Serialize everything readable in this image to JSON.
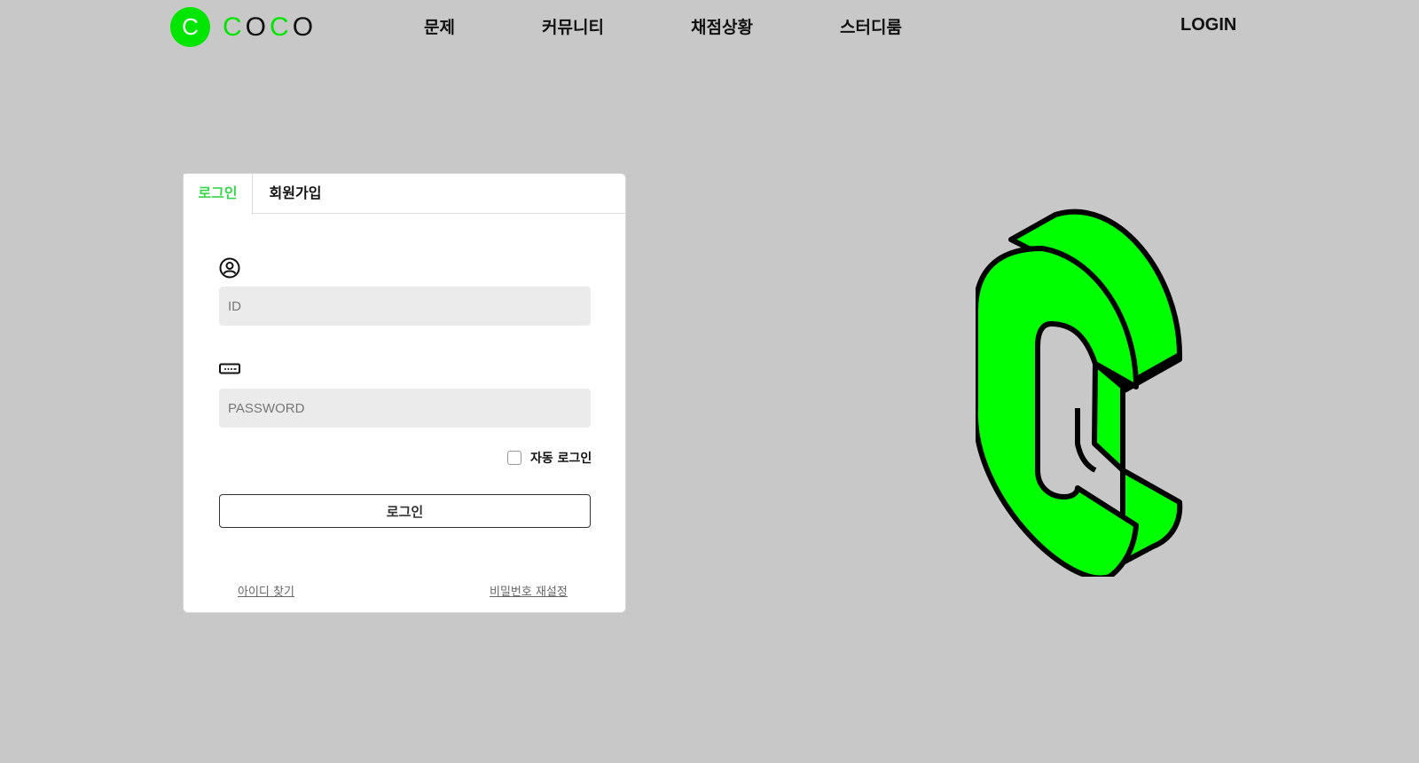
{
  "brand": {
    "logo_letter": "C",
    "name_letters": [
      "C",
      "O",
      "C",
      "O"
    ],
    "accent_color": "#00e600"
  },
  "nav": {
    "items": [
      {
        "label": "문제"
      },
      {
        "label": "커뮤니티"
      },
      {
        "label": "채점상황"
      },
      {
        "label": "스터디룸"
      }
    ],
    "login_label": "LOGIN"
  },
  "auth_card": {
    "tabs": [
      {
        "label": "로그인",
        "active": true
      },
      {
        "label": "회원가입",
        "active": false
      }
    ],
    "id_field": {
      "icon": "user-circle-icon",
      "placeholder": "ID",
      "value": ""
    },
    "password_field": {
      "icon": "password-icon",
      "placeholder": "PASSWORD",
      "value": ""
    },
    "auto_login": {
      "label": "자동 로그인",
      "checked": false
    },
    "submit_label": "로그인",
    "find_id_label": "아이디 찾기",
    "reset_password_label": "비밀번호 재설정"
  },
  "hero": {
    "icon": "isometric-c-logo"
  }
}
